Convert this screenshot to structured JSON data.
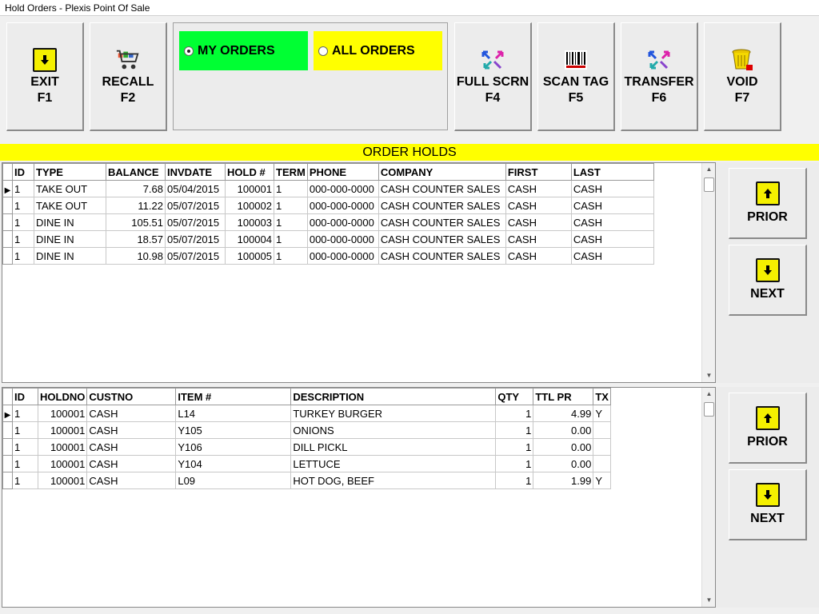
{
  "window": {
    "title": "Hold Orders - Plexis Point Of Sale"
  },
  "toolbar": {
    "exit": {
      "label": "EXIT",
      "key": "F1"
    },
    "recall": {
      "label": "RECALL",
      "key": "F2"
    },
    "fullscrn": {
      "label": "FULL SCRN",
      "key": "F4"
    },
    "scantag": {
      "label": "SCAN TAG",
      "key": "F5"
    },
    "transfer": {
      "label": "TRANSFER",
      "key": "F6"
    },
    "void": {
      "label": "VOID",
      "key": "F7"
    }
  },
  "filter": {
    "my_orders": {
      "label": "MY ORDERS",
      "color": "#00ff33",
      "selected": true
    },
    "all_orders": {
      "label": "ALL ORDERS",
      "color": "#ffff00",
      "selected": false
    }
  },
  "banner": {
    "title": "ORDER HOLDS",
    "color": "#ffff00"
  },
  "holds": {
    "columns": [
      "ID",
      "TYPE",
      "BALANCE",
      "INVDATE",
      "HOLD #",
      "TERM",
      "PHONE",
      "COMPANY",
      "FIRST",
      "LAST"
    ],
    "rows": [
      [
        "1",
        "TAKE OUT",
        "7.68",
        "05/04/2015",
        "100001",
        "1",
        "000-000-0000",
        "CASH COUNTER SALES",
        "CASH",
        "CASH"
      ],
      [
        "1",
        "TAKE OUT",
        "11.22",
        "05/07/2015",
        "100002",
        "1",
        "000-000-0000",
        "CASH COUNTER SALES",
        "CASH",
        "CASH"
      ],
      [
        "1",
        "DINE IN",
        "105.51",
        "05/07/2015",
        "100003",
        "1",
        "000-000-0000",
        "CASH COUNTER SALES",
        "CASH",
        "CASH"
      ],
      [
        "1",
        "DINE IN",
        "18.57",
        "05/07/2015",
        "100004",
        "1",
        "000-000-0000",
        "CASH COUNTER SALES",
        "CASH",
        "CASH"
      ],
      [
        "1",
        "DINE IN",
        "10.98",
        "05/07/2015",
        "100005",
        "1",
        "000-000-0000",
        "CASH COUNTER SALES",
        "CASH",
        "CASH"
      ]
    ]
  },
  "items": {
    "columns": [
      "ID",
      "HOLDNO",
      "CUSTNO",
      "ITEM #",
      "DESCRIPTION",
      "QTY",
      "TTL PR",
      "TX"
    ],
    "rows": [
      [
        "1",
        "100001",
        "CASH",
        "L14",
        "TURKEY BURGER",
        "1",
        "4.99",
        "Y"
      ],
      [
        "1",
        "100001",
        "CASH",
        "Y105",
        " ONIONS",
        "1",
        "0.00",
        ""
      ],
      [
        "1",
        "100001",
        "CASH",
        "Y106",
        " DILL PICKL",
        "1",
        "0.00",
        ""
      ],
      [
        "1",
        "100001",
        "CASH",
        "Y104",
        " LETTUCE",
        "1",
        "0.00",
        ""
      ],
      [
        "1",
        "100001",
        "CASH",
        "L09",
        "HOT DOG, BEEF",
        "1",
        "1.99",
        "Y"
      ]
    ]
  },
  "nav": {
    "prior": "PRIOR",
    "next": "NEXT"
  }
}
